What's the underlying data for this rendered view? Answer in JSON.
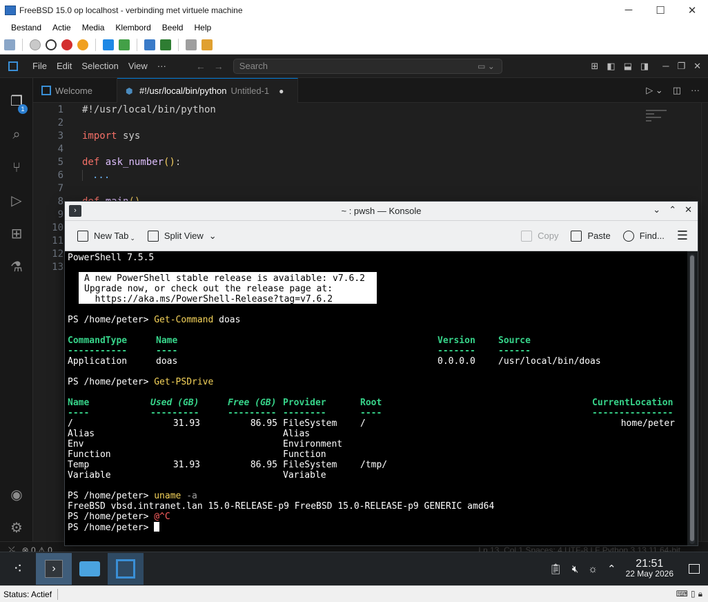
{
  "host": {
    "title": "FreeBSD 15.0 op localhost - verbinding met virtuele machine",
    "menu": [
      "Bestand",
      "Actie",
      "Media",
      "Klembord",
      "Beeld",
      "Help"
    ],
    "status": "Status: Actief",
    "window_buttons": [
      "─",
      "☐",
      "✕"
    ]
  },
  "vscode": {
    "menu": [
      "File",
      "Edit",
      "Selection",
      "View",
      "···"
    ],
    "search_placeholder": "Search",
    "tabs": [
      {
        "label": "Welcome"
      },
      {
        "label": "#!/usr/local/bin/python",
        "sub": "Untitled-1",
        "modified": "●"
      }
    ],
    "explorer_badge": "1",
    "line_numbers": [
      "1",
      "2",
      "3",
      "4",
      "5",
      "6",
      "7",
      "8",
      "9",
      "10",
      "11",
      "12",
      "13"
    ],
    "code": {
      "l1": "#!/usr/local/bin/python",
      "l3_kw": "import",
      "l3_rest": " sys",
      "l5_kw": "def",
      "l5_fn": "ask_number",
      "l5_par": "()",
      "l5_colon": ":",
      "l6": "...",
      "l8_kw": "def",
      "l8_fn": "main",
      "l8_par": "()"
    },
    "status_left": "⊗ 0 ⚠ 0",
    "status_right": "Ln 13, Col 1   Spaces: 4   UTF-8   LF   Python   3.13.11 64-bit"
  },
  "konsole": {
    "title": "~ : pwsh — Konsole",
    "toolbar": {
      "new_tab": "New Tab",
      "split_view": "Split View",
      "copy": "Copy",
      "paste": "Paste",
      "find": "Find..."
    },
    "terminal": {
      "version_line": "PowerShell 7.5.5",
      "notice": [
        "A new PowerShell stable release is available: v7.6.2",
        "Upgrade now, or check out the release page at:",
        "  https://aka.ms/PowerShell-Release?tag=v7.6.2"
      ],
      "prompt": "PS /home/peter> ",
      "cmd1": "Get-Command",
      "cmd1_arg": " doas",
      "gc_headers": [
        "CommandType",
        "Name",
        "Version",
        "Source"
      ],
      "gc_rules": [
        "-----------",
        "----",
        "-------",
        "------"
      ],
      "gc_row": [
        "Application",
        "doas",
        "0.0.0.0",
        "/usr/local/bin/doas"
      ],
      "cmd2": "Get-PSDrive",
      "ps_headers": [
        "Name",
        "Used (GB)",
        "Free (GB)",
        "Provider",
        "Root",
        "CurrentLocation"
      ],
      "ps_rules": [
        "----",
        "---------",
        "---------",
        "--------",
        "----",
        "---------------"
      ],
      "ps_rows": [
        {
          "name": "/",
          "used": "31.93",
          "free": "86.95",
          "provider": "FileSystem",
          "root": "/",
          "loc": "home/peter"
        },
        {
          "name": "Alias",
          "used": "",
          "free": "",
          "provider": "Alias",
          "root": "",
          "loc": ""
        },
        {
          "name": "Env",
          "used": "",
          "free": "",
          "provider": "Environment",
          "root": "",
          "loc": ""
        },
        {
          "name": "Function",
          "used": "",
          "free": "",
          "provider": "Function",
          "root": "",
          "loc": ""
        },
        {
          "name": "Temp",
          "used": "31.93",
          "free": "86.95",
          "provider": "FileSystem",
          "root": "/tmp/",
          "loc": ""
        },
        {
          "name": "Variable",
          "used": "",
          "free": "",
          "provider": "Variable",
          "root": "",
          "loc": ""
        }
      ],
      "cmd3": "uname",
      "cmd3_arg": " -a",
      "uname_out": "FreeBSD vbsd.intranet.lan 15.0-RELEASE-p9 FreeBSD 15.0-RELEASE-p9 GENERIC amd64",
      "prompt_err": "PS /home/peter> ",
      "interrupt": "@^C",
      "last_prompt": "PS /home/peter> "
    }
  },
  "panel": {
    "time": "21:51",
    "date": "22 May 2026"
  }
}
